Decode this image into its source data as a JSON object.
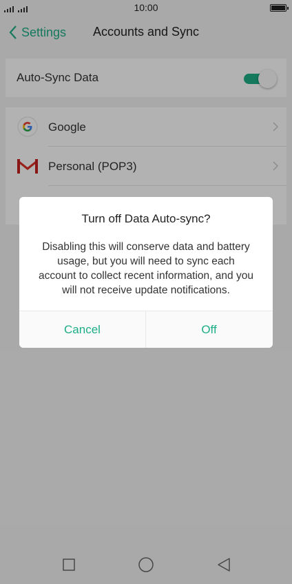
{
  "status_bar": {
    "time": "10:00"
  },
  "top_bar": {
    "back_label": "Settings",
    "title": "Accounts and Sync"
  },
  "auto_sync": {
    "label": "Auto-Sync Data",
    "enabled": true
  },
  "accounts": [
    {
      "label": "Google",
      "icon": "google-icon"
    },
    {
      "label": "Personal (POP3)",
      "icon": "gmail-icon"
    }
  ],
  "dialog": {
    "title": "Turn off Data Auto-sync?",
    "message": "Disabling this will conserve data and battery usage, but you will need to sync each account to collect recent information, and you will not receive update notifications.",
    "cancel_label": "Cancel",
    "confirm_label": "Off"
  },
  "colors": {
    "accent": "#1dae86",
    "background": "#f3f3f3",
    "scrim": "rgba(0,0,0,0.30)"
  }
}
